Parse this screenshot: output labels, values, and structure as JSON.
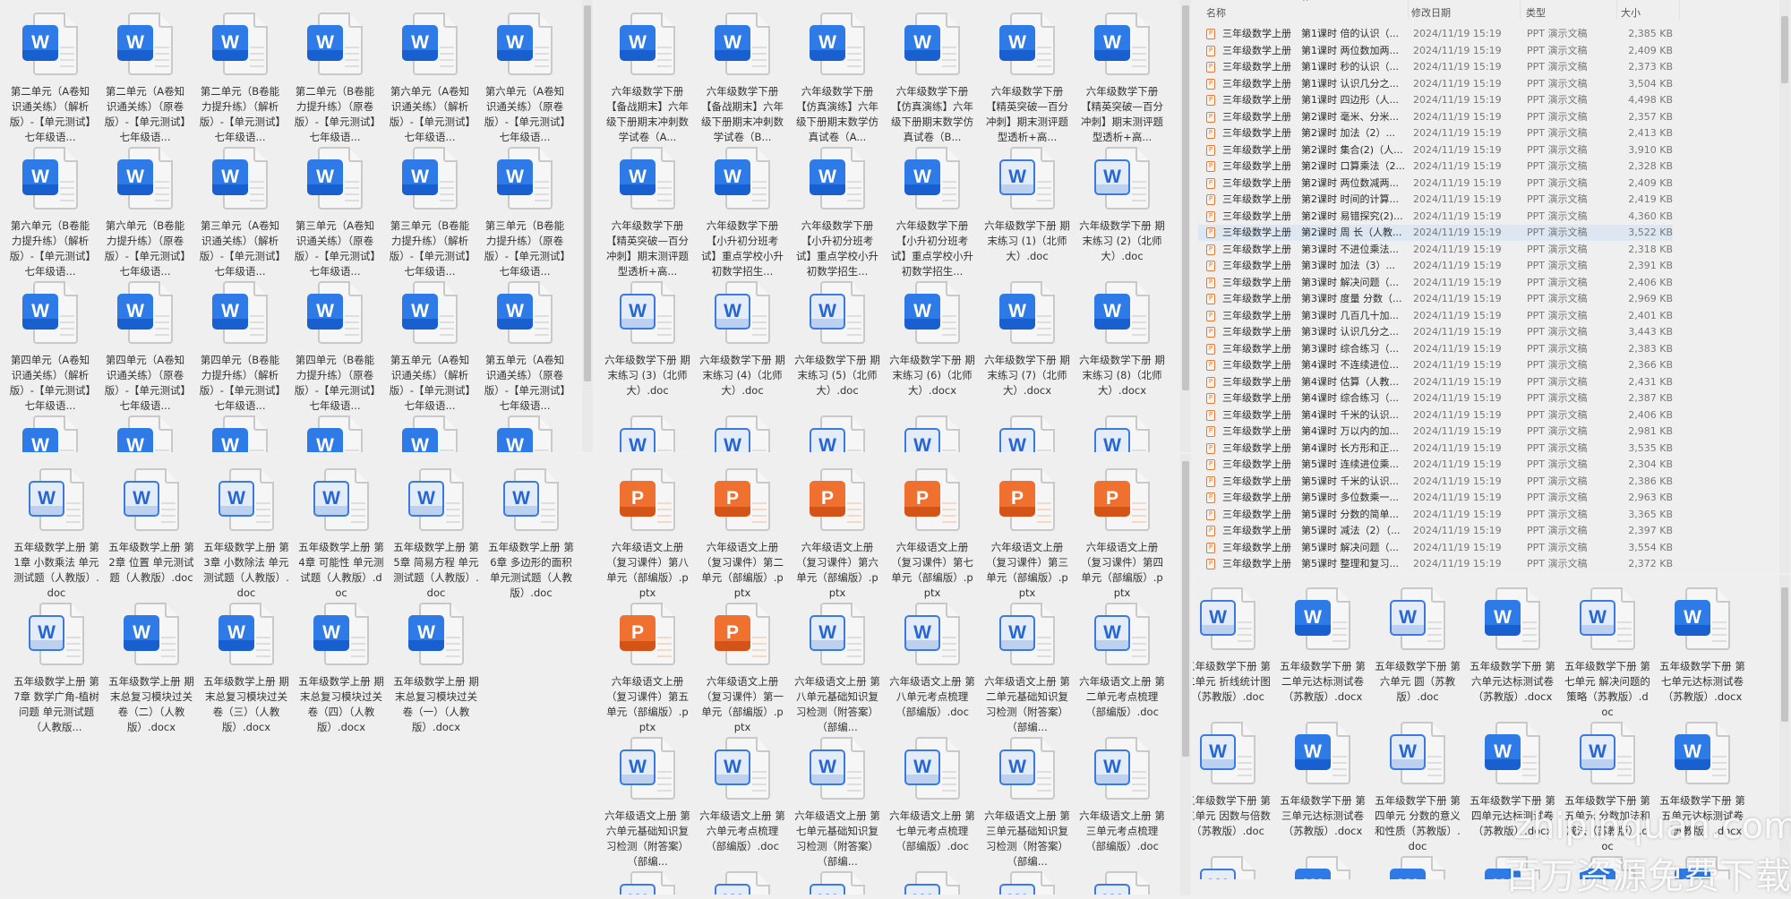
{
  "panels": {
    "top_left": {
      "items": [
        {
          "icon": "word",
          "label": "第二单元（A卷知识通关练）（解析版）-【单元测试】七年级语..."
        },
        {
          "icon": "word",
          "label": "第二单元（A卷知识通关练）（原卷版）-【单元测试】七年级语..."
        },
        {
          "icon": "word",
          "label": "第二单元（B卷能力提升练）（解析版）-【单元测试】七年级语..."
        },
        {
          "icon": "word",
          "label": "第二单元（B卷能力提升练）（原卷版）-【单元测试】七年级语..."
        },
        {
          "icon": "word",
          "label": "第六单元（A卷知识通关练）（解析版）-【单元测试】七年级语..."
        },
        {
          "icon": "word",
          "label": "第六单元（A卷知识通关练）（原卷版）-【单元测试】七年级语..."
        },
        {
          "icon": "word",
          "label": "第六单元（B卷能力提升练）（解析版）-【单元测试】七年级语..."
        },
        {
          "icon": "word",
          "label": "第六单元（B卷能力提升练）（原卷版）-【单元测试】七年级语..."
        },
        {
          "icon": "word",
          "label": "第三单元（A卷知识通关练）（解析版）-【单元测试】七年级语..."
        },
        {
          "icon": "word",
          "label": "第三单元（A卷知识通关练）（原卷版）-【单元测试】七年级语..."
        },
        {
          "icon": "word",
          "label": "第三单元（B卷能力提升练）（解析版）-【单元测试】七年级语..."
        },
        {
          "icon": "word",
          "label": "第三单元（B卷能力提升练）（原卷版）-【单元测试】七年级语..."
        },
        {
          "icon": "word",
          "label": "第四单元（A卷知识通关练）（解析版）-【单元测试】七年级语..."
        },
        {
          "icon": "word",
          "label": "第四单元（A卷知识通关练）（原卷版）-【单元测试】七年级语..."
        },
        {
          "icon": "word",
          "label": "第四单元（B卷能力提升练）（解析版）-【单元测试】七年级语..."
        },
        {
          "icon": "word",
          "label": "第四单元（B卷能力提升练）（原卷版）-【单元测试】七年级语..."
        },
        {
          "icon": "word",
          "label": "第五单元（A卷知识通关练）（解析版）-【单元测试】七年级语..."
        },
        {
          "icon": "word",
          "label": "第五单元（A卷知识通关练）（原卷版）-【单元测试】七年级语..."
        },
        {
          "icon": "word"
        },
        {
          "icon": "word"
        },
        {
          "icon": "word"
        },
        {
          "icon": "word"
        },
        {
          "icon": "word"
        },
        {
          "icon": "word"
        }
      ]
    },
    "bottom_left": {
      "items": [
        {
          "icon": "wordo",
          "label": "五年级数学上册 第1章 小数乘法 单元测试题（人教版）.doc"
        },
        {
          "icon": "wordo",
          "label": "五年级数学上册 第2章 位置 单元测试题（人教版）.doc"
        },
        {
          "icon": "wordo",
          "label": "五年级数学上册 第3章 小数除法 单元测试题（人教版）.doc"
        },
        {
          "icon": "wordo",
          "label": "五年级数学上册 第4章 可能性 单元测试题（人教版）.doc"
        },
        {
          "icon": "wordo",
          "label": "五年级数学上册 第5章 简易方程 单元测试题（人教版）.doc"
        },
        {
          "icon": "wordo",
          "label": "五年级数学上册 第6章 多边形的面积 单元测试题（人教版）.doc"
        },
        {
          "icon": "wordo",
          "label": "五年级数学上册 第7章 数学广角-植树问题 单元测试题（人教版..."
        },
        {
          "icon": "word",
          "label": "五年级数学上册 期末总复习模块过关卷（二）（人教版）.docx"
        },
        {
          "icon": "word",
          "label": "五年级数学上册 期末总复习模块过关卷（三）（人教版）.docx"
        },
        {
          "icon": "word",
          "label": "五年级数学上册 期末总复习模块过关卷（四）（人教版）.docx"
        },
        {
          "icon": "word",
          "label": "五年级数学上册 期末总复习模块过关卷（一）（人教版）.docx"
        }
      ]
    },
    "top_middle": {
      "items": [
        {
          "icon": "word",
          "label": "六年级数学下册【备战期末】六年级下册期末冲刺数学试卷（A..."
        },
        {
          "icon": "word",
          "label": "六年级数学下册【备战期末】六年级下册期末冲刺数学试卷（B..."
        },
        {
          "icon": "word",
          "label": "六年级数学下册【仿真演练】六年级下册期末数学仿真试卷（A..."
        },
        {
          "icon": "word",
          "label": "六年级数学下册【仿真演练】六年级下册期末数学仿真试卷（B..."
        },
        {
          "icon": "word",
          "label": "六年级数学下册【精英突破—百分冲刺】期末测评题型透析+高..."
        },
        {
          "icon": "word",
          "label": "六年级数学下册【精英突破—百分冲刺】期末测评题型透析+高..."
        },
        {
          "icon": "word",
          "label": "六年级数学下册【精英突破—百分冲刺】期末测评题型透析+高..."
        },
        {
          "icon": "word",
          "label": "六年级数学下册【小升初分班考试】重点学校小升初数学招生..."
        },
        {
          "icon": "word",
          "label": "六年级数学下册【小升初分班考试】重点学校小升初数学招生..."
        },
        {
          "icon": "word",
          "label": "六年级数学下册【小升初分班考试】重点学校小升初数学招生..."
        },
        {
          "icon": "wordo",
          "label": "六年级数学下册 期末练习 (1)（北师大）.doc"
        },
        {
          "icon": "wordo",
          "label": "六年级数学下册 期末练习 (2)（北师大）.doc"
        },
        {
          "icon": "wordo",
          "label": "六年级数学下册 期末练习 (3)（北师大）.doc"
        },
        {
          "icon": "wordo",
          "label": "六年级数学下册 期末练习 (4)（北师大）.doc"
        },
        {
          "icon": "wordo",
          "label": "六年级数学下册 期末练习 (5)（北师大）.doc"
        },
        {
          "icon": "word",
          "label": "六年级数学下册 期末练习 (6)（北师大）.docx"
        },
        {
          "icon": "word",
          "label": "六年级数学下册 期末练习 (7)（北师大）.docx"
        },
        {
          "icon": "word",
          "label": "六年级数学下册 期末练习 (8)（北师大）.docx"
        },
        {
          "icon": "wordo"
        },
        {
          "icon": "wordo"
        },
        {
          "icon": "wordo"
        },
        {
          "icon": "wordo"
        },
        {
          "icon": "wordo"
        },
        {
          "icon": "wordo"
        }
      ]
    },
    "bottom_middle": {
      "items": [
        {
          "icon": "ppt",
          "label": "六年级语文上册（复习课件）第八单元（部编版）.pptx"
        },
        {
          "icon": "ppt",
          "label": "六年级语文上册（复习课件）第二单元（部编版）.pptx"
        },
        {
          "icon": "ppt",
          "label": "六年级语文上册（复习课件）第六单元（部编版）.pptx"
        },
        {
          "icon": "ppt",
          "label": "六年级语文上册（复习课件）第七单元（部编版）.pptx"
        },
        {
          "icon": "ppt",
          "label": "六年级语文上册（复习课件）第三单元（部编版）.pptx"
        },
        {
          "icon": "ppt",
          "label": "六年级语文上册（复习课件）第四单元（部编版）.pptx"
        },
        {
          "icon": "ppt",
          "label": "六年级语文上册（复习课件）第五单元（部编版）.pptx"
        },
        {
          "icon": "ppt",
          "label": "六年级语文上册（复习课件）第一单元（部编版）.pptx"
        },
        {
          "icon": "wordo",
          "label": "六年级语文上册 第八单元基础知识复习检测（附答案）（部编..."
        },
        {
          "icon": "wordo",
          "label": "六年级语文上册 第八单元考点梳理（部编版）.doc"
        },
        {
          "icon": "wordo",
          "label": "六年级语文上册 第二单元基础知识复习检测（附答案）（部编..."
        },
        {
          "icon": "wordo",
          "label": "六年级语文上册 第二单元考点梳理（部编版）.doc"
        },
        {
          "icon": "wordo",
          "label": "六年级语文上册 第六单元基础知识复习检测（附答案）（部编..."
        },
        {
          "icon": "wordo",
          "label": "六年级语文上册 第六单元考点梳理（部编版）.doc"
        },
        {
          "icon": "wordo",
          "label": "六年级语文上册 第七单元基础知识复习检测（附答案）（部编..."
        },
        {
          "icon": "wordo",
          "label": "六年级语文上册 第七单元考点梳理（部编版）.doc"
        },
        {
          "icon": "wordo",
          "label": "六年级语文上册 第三单元基础知识复习检测（附答案）（部编..."
        },
        {
          "icon": "wordo",
          "label": "六年级语文上册 第三单元考点梳理（部编版）.doc"
        },
        {
          "icon": "wordo"
        },
        {
          "icon": "wordo"
        },
        {
          "icon": "wordo"
        },
        {
          "icon": "wordo"
        },
        {
          "icon": "wordo"
        },
        {
          "icon": "wordo"
        }
      ]
    },
    "bottom_right": {
      "items": [
        {
          "icon": "wordo",
          "label": "五年级数学下册 第二单元 折线统计图（苏教版）.doc"
        },
        {
          "icon": "word",
          "label": "五年级数学下册 第二单元达标测试卷（苏教版）.docx"
        },
        {
          "icon": "wordo",
          "label": "五年级数学下册 第六单元 圆（苏教版）.doc"
        },
        {
          "icon": "word",
          "label": "五年级数学下册 第六单元达标测试卷（苏教版）.docx"
        },
        {
          "icon": "wordo",
          "label": "五年级数学下册 第七单元 解决问题的策略（苏教版）.doc"
        },
        {
          "icon": "word",
          "label": "五年级数学下册 第七单元达标测试卷（苏教版）.docx"
        },
        {
          "icon": "wordo",
          "label": "五年级数学下册 第三单元 因数与倍数（苏教版）.doc"
        },
        {
          "icon": "word",
          "label": "五年级数学下册 第三单元达标测试卷（苏教版）.docx"
        },
        {
          "icon": "wordo",
          "label": "五年级数学下册 第四单元 分数的意义和性质（苏教版）.doc"
        },
        {
          "icon": "word",
          "label": "五年级数学下册 第四单元达标测试卷（苏教版）.docx"
        },
        {
          "icon": "wordo",
          "label": "五年级数学下册 第五单元 分数加法和减法（苏教版）.doc"
        },
        {
          "icon": "word",
          "label": "五年级数学下册 第五单元达标测试卷（苏教版）.docx"
        },
        {
          "icon": "wordo"
        },
        {
          "icon": "word"
        },
        {
          "icon": "word"
        },
        {
          "icon": "word"
        },
        {
          "icon": "word"
        },
        {
          "icon": "word"
        }
      ]
    }
  },
  "list": {
    "columns": {
      "name": "名称",
      "modified": "修改日期",
      "type": "类型",
      "size": "大小"
    },
    "selected_index": 12,
    "rows": [
      {
        "a": "三年级数学上册",
        "b": "第1课时 倍的认识（...",
        "date": "2024/11/19 15:19",
        "type": "PPT 演示文稿",
        "size": "2,385 KB"
      },
      {
        "a": "三年级数学上册",
        "b": "第1课时 两位数加两...",
        "date": "2024/11/19 15:19",
        "type": "PPT 演示文稿",
        "size": "2,409 KB"
      },
      {
        "a": "三年级数学上册",
        "b": "第1课时 秒的认识（...",
        "date": "2024/11/19 15:19",
        "type": "PPT 演示文稿",
        "size": "2,373 KB"
      },
      {
        "a": "三年级数学上册",
        "b": "第1课时 认识几分之...",
        "date": "2024/11/19 15:19",
        "type": "PPT 演示文稿",
        "size": "3,504 KB"
      },
      {
        "a": "三年级数学上册",
        "b": "第1课时 四边形（人...",
        "date": "2024/11/19 15:19",
        "type": "PPT 演示文稿",
        "size": "4,498 KB"
      },
      {
        "a": "三年级数学上册",
        "b": "第2课时  毫米、分米...",
        "date": "2024/11/19 15:19",
        "type": "PPT 演示文稿",
        "size": "2,357 KB"
      },
      {
        "a": "三年级数学上册",
        "b": "第2课时  加法（2）...",
        "date": "2024/11/19 15:19",
        "type": "PPT 演示文稿",
        "size": "2,413 KB"
      },
      {
        "a": "三年级数学上册",
        "b": "第2课时 集合(2)（人...",
        "date": "2024/11/19 15:19",
        "type": "PPT 演示文稿",
        "size": "3,910 KB"
      },
      {
        "a": "三年级数学上册",
        "b": "第2课时 口算乘法（2...",
        "date": "2024/11/19 15:19",
        "type": "PPT 演示文稿",
        "size": "2,328 KB"
      },
      {
        "a": "三年级数学上册",
        "b": "第2课时 两位数减两...",
        "date": "2024/11/19 15:19",
        "type": "PPT 演示文稿",
        "size": "2,409 KB"
      },
      {
        "a": "三年级数学上册",
        "b": "第2课时 时间的计算...",
        "date": "2024/11/19 15:19",
        "type": "PPT 演示文稿",
        "size": "2,419 KB"
      },
      {
        "a": "三年级数学上册",
        "b": "第2课时 易错探究(2)...",
        "date": "2024/11/19 15:19",
        "type": "PPT 演示文稿",
        "size": "4,360 KB"
      },
      {
        "a": "三年级数学上册",
        "b": "第2课时 周 长（人教...",
        "date": "2024/11/19 15:19",
        "type": "PPT 演示文稿",
        "size": "3,522 KB"
      },
      {
        "a": "三年级数学上册",
        "b": "第3课时  不进位乘法...",
        "date": "2024/11/19 15:19",
        "type": "PPT 演示文稿",
        "size": "2,318 KB"
      },
      {
        "a": "三年级数学上册",
        "b": "第3课时  加法（3）...",
        "date": "2024/11/19 15:19",
        "type": "PPT 演示文稿",
        "size": "2,391 KB"
      },
      {
        "a": "三年级数学上册",
        "b": "第3课时  解决问题（...",
        "date": "2024/11/19 15:19",
        "type": "PPT 演示文稿",
        "size": "2,406 KB"
      },
      {
        "a": "三年级数学上册",
        "b": "第3课时 度量 分数（...",
        "date": "2024/11/19 15:19",
        "type": "PPT 演示文稿",
        "size": "2,969 KB"
      },
      {
        "a": "三年级数学上册",
        "b": "第3课时 几百几十加...",
        "date": "2024/11/19 15:19",
        "type": "PPT 演示文稿",
        "size": "2,401 KB"
      },
      {
        "a": "三年级数学上册",
        "b": "第3课时 认识几分之...",
        "date": "2024/11/19 15:19",
        "type": "PPT 演示文稿",
        "size": "3,443 KB"
      },
      {
        "a": "三年级数学上册",
        "b": "第3课时 综合练习（...",
        "date": "2024/11/19 15:19",
        "type": "PPT 演示文稿",
        "size": "2,383 KB"
      },
      {
        "a": "三年级数学上册",
        "b": "第4课时  不连续进位...",
        "date": "2024/11/19 15:19",
        "type": "PPT 演示文稿",
        "size": "2,366 KB"
      },
      {
        "a": "三年级数学上册",
        "b": "第4课时  估算（人教...",
        "date": "2024/11/19 15:19",
        "type": "PPT 演示文稿",
        "size": "2,431 KB"
      },
      {
        "a": "三年级数学上册",
        "b": "第4课时  综合练习（...",
        "date": "2024/11/19 15:19",
        "type": "PPT 演示文稿",
        "size": "2,387 KB"
      },
      {
        "a": "三年级数学上册",
        "b": "第4课时 千米的认识...",
        "date": "2024/11/19 15:19",
        "type": "PPT 演示文稿",
        "size": "2,406 KB"
      },
      {
        "a": "三年级数学上册",
        "b": "第4课时 万以内的加...",
        "date": "2024/11/19 15:19",
        "type": "PPT 演示文稿",
        "size": "2,981 KB"
      },
      {
        "a": "三年级数学上册",
        "b": "第4课时 长方形和正...",
        "date": "2024/11/19 15:19",
        "type": "PPT 演示文稿",
        "size": "3,535 KB"
      },
      {
        "a": "三年级数学上册",
        "b": "第5课时  连续进位乘...",
        "date": "2024/11/19 15:19",
        "type": "PPT 演示文稿",
        "size": "2,304 KB"
      },
      {
        "a": "三年级数学上册",
        "b": "第5课时  千米的认识...",
        "date": "2024/11/19 15:19",
        "type": "PPT 演示文稿",
        "size": "2,386 KB"
      },
      {
        "a": "三年级数学上册",
        "b": "第5课时 多位数乘一...",
        "date": "2024/11/19 15:19",
        "type": "PPT 演示文稿",
        "size": "2,963 KB"
      },
      {
        "a": "三年级数学上册",
        "b": "第5课时 分数的简单...",
        "date": "2024/11/19 15:19",
        "type": "PPT 演示文稿",
        "size": "3,365 KB"
      },
      {
        "a": "三年级数学上册",
        "b": "第5课时 减法（2）（...",
        "date": "2024/11/19 15:19",
        "type": "PPT 演示文稿",
        "size": "2,397 KB"
      },
      {
        "a": "三年级数学上册",
        "b": "第5课时 解决问题（...",
        "date": "2024/11/19 15:19",
        "type": "PPT 演示文稿",
        "size": "3,554 KB"
      },
      {
        "a": "三年级数学上册",
        "b": "第5课时 整理和复习...",
        "date": "2024/11/19 15:19",
        "type": "PPT 演示文稿",
        "size": "2,372 KB"
      }
    ]
  },
  "watermark": {
    "line1": "zhipinquan.com",
    "line2": "百万资源免费下载"
  },
  "icon_glyphs": {
    "word": "W",
    "wordo": "W",
    "ppt": "P",
    "ppt_small": "P"
  },
  "colors": {
    "word_blue": "#1a5fd0",
    "ppt_orange": "#e0601e",
    "selection": "#dde7f2"
  }
}
